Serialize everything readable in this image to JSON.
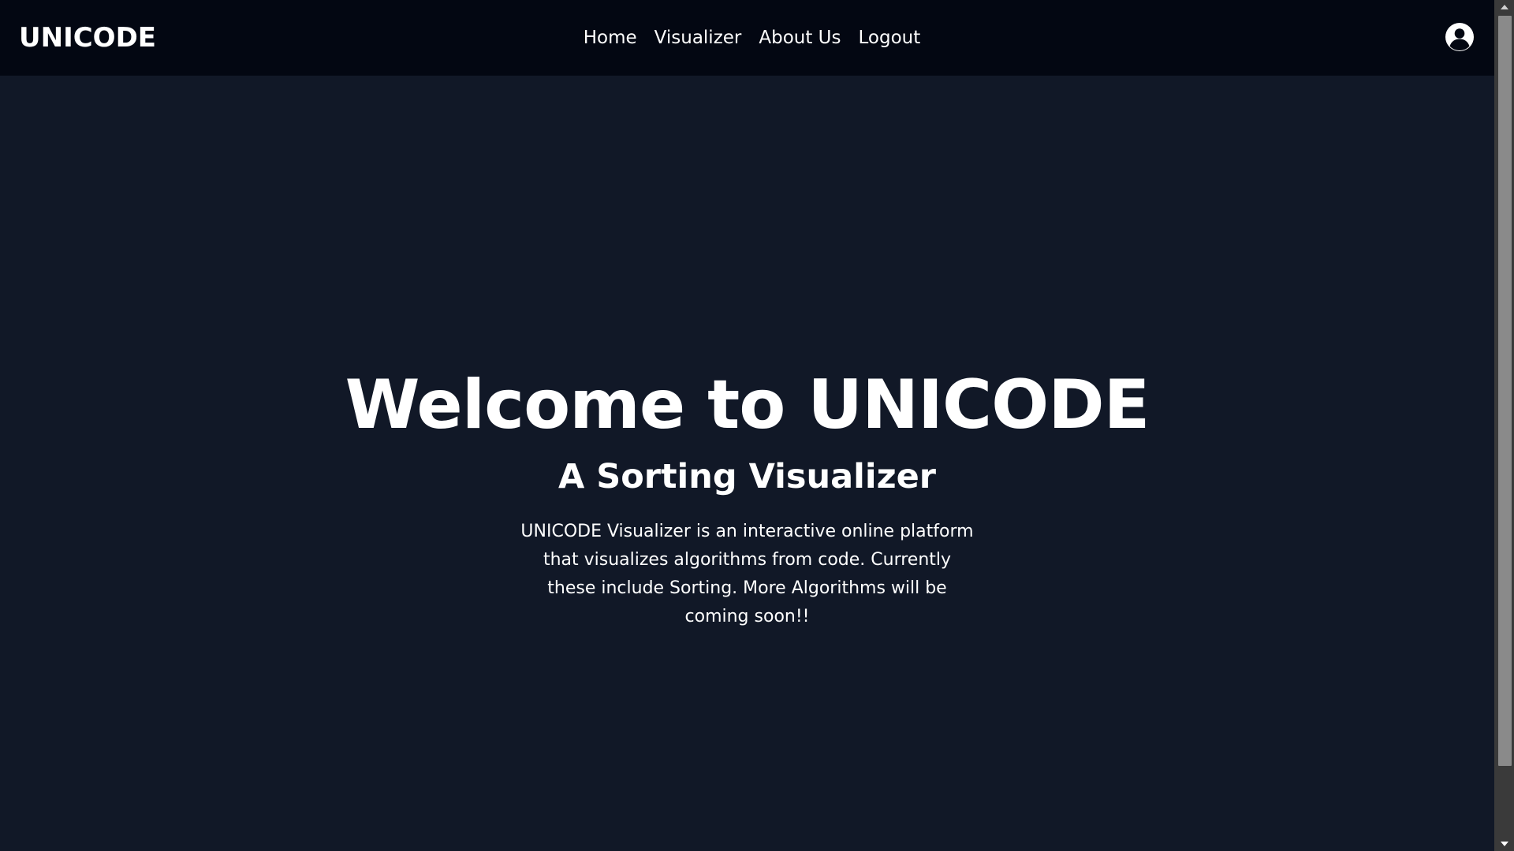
{
  "navbar": {
    "brand": "UNICODE",
    "links": [
      {
        "label": "Home"
      },
      {
        "label": "Visualizer"
      },
      {
        "label": "About Us"
      },
      {
        "label": "Logout"
      }
    ],
    "user_icon": "user-circle-icon"
  },
  "hero": {
    "title": "Welcome to UNICODE",
    "subtitle": "A Sorting Visualizer",
    "description": "UNICODE Visualizer is an interactive online platform that visualizes algorithms from code. Currently these include Sorting. More Algorithms will be coming soon!!"
  },
  "colors": {
    "navbar_bg": "#030712",
    "page_bg": "#111827",
    "text": "#ffffff"
  },
  "scrollbar": {
    "up_icon": "scroll-up-arrow-icon",
    "down_icon": "scroll-down-arrow-icon"
  }
}
